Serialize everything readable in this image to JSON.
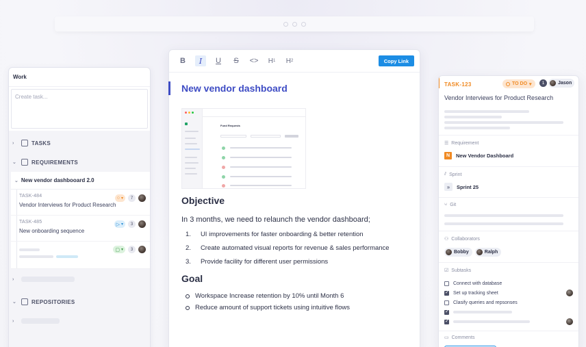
{
  "left_panel": {
    "title": "Work",
    "create_placeholder": "Create task...",
    "sections": {
      "tasks": "TASKS",
      "requirements": "REQUIREMENTS",
      "repositories": "REPOSITORIES"
    },
    "group": {
      "title": "New vendor dashbooard 2.0",
      "items": [
        {
          "id": "TASK-484",
          "title": "Vendor Interviews for Product Research",
          "status": "orange",
          "count": "7"
        },
        {
          "id": "TASK-485",
          "title": "New onboarding sequence",
          "status": "blue",
          "count": "3"
        },
        {
          "id": "",
          "title": "",
          "status": "green",
          "count": "3"
        }
      ]
    }
  },
  "editor": {
    "toolbar": {
      "bold": "B",
      "italic": "I",
      "underline": "U",
      "strike": "S",
      "code": "<>",
      "h1": "H",
      "h1_sub": "1",
      "h2": "H",
      "h2_sub": "2",
      "copy_link": "Copy Link"
    },
    "title": "New vendor dashboard",
    "objective_heading": "Objective",
    "objective_text": "In 3 months, we need to relaunch the vendor dashboard;",
    "objective_list": [
      "UI improvements for faster onboarding & better retention",
      "Create automated visual reports for revenue & sales performance",
      "Provide facility for different user permissions"
    ],
    "goal_heading": "Goal",
    "goal_list": [
      "Workspace Increase retention by 10% until Month 6",
      "Reduce amount of support tickets using intuitive flows"
    ],
    "screenshot": {
      "heading": "Fund Requests"
    }
  },
  "right_panel": {
    "task_id": "TASK-123",
    "status": "TO DO",
    "count": "1",
    "assignee": "Jason",
    "title": "Vendor Interviews for Product Research",
    "requirement_label": "Requirement",
    "requirement_badge": "N",
    "requirement_value": "New Vendor Dashboard",
    "sprint_label": "Sprint",
    "sprint_value": "Sprint 25",
    "git_label": "Git",
    "collaborators_label": "Collaborators",
    "collaborators": [
      "Bobby",
      "Ralph"
    ],
    "subtasks_label": "Subtasks",
    "subtasks": [
      {
        "text": "Connect with database",
        "checked": false
      },
      {
        "text": "Set up tracking sheet",
        "checked": true
      },
      {
        "text": "Clasify queries and repsonses",
        "checked": false
      },
      {
        "text": "",
        "checked": true
      },
      {
        "text": "",
        "checked": true
      }
    ],
    "comments_label": "Comments"
  },
  "colors": {
    "accent_blue": "#1c8de4",
    "title_indigo": "#3e4cc4",
    "todo_orange": "#f08a23"
  }
}
